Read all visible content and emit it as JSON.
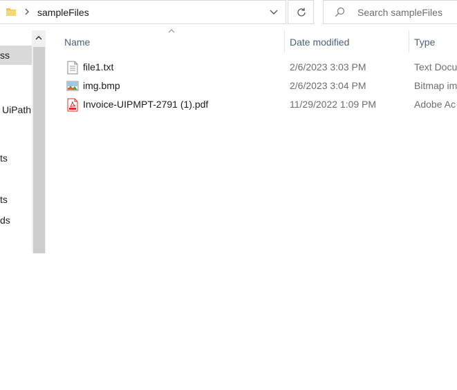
{
  "address_bar": {
    "breadcrumb": "sampleFiles",
    "folder_icon": "folder-icon",
    "separator_icon": "chevron-right-icon",
    "dropdown_icon": "chevron-down-icon"
  },
  "refresh": {
    "icon": "refresh-icon"
  },
  "search": {
    "placeholder": "Search sampleFiles",
    "value": "",
    "icon": "search-icon"
  },
  "nav": {
    "items": [
      {
        "label": "ss",
        "selected": true
      },
      {
        "label": "UiPath",
        "selected": false
      },
      {
        "label": "ts",
        "selected": false
      },
      {
        "label": "ts",
        "selected": false
      },
      {
        "label": "ds",
        "selected": false
      }
    ]
  },
  "columns": {
    "name": "Name",
    "date_modified": "Date modified",
    "type": "Type",
    "sorted_by": "name"
  },
  "files": [
    {
      "name": "file1.txt",
      "date": "2/6/2023 3:03 PM",
      "type": "Text Docu",
      "icon": "text-file-icon"
    },
    {
      "name": "img.bmp",
      "date": "2/6/2023 3:04 PM",
      "type": "Bitmap im",
      "icon": "bitmap-image-icon"
    },
    {
      "name": "Invoice-UIPMPT-2791 (1).pdf",
      "date": "11/29/2022 1:09 PM",
      "type": "Adobe Ac",
      "icon": "pdf-file-icon"
    }
  ],
  "colors": {
    "header_text": "#4c607a",
    "secondary_text": "#6d6d6d",
    "selected_nav": "#d9d9d9",
    "folder_yellow": "#f5c542",
    "pdf_red": "#d93025"
  }
}
